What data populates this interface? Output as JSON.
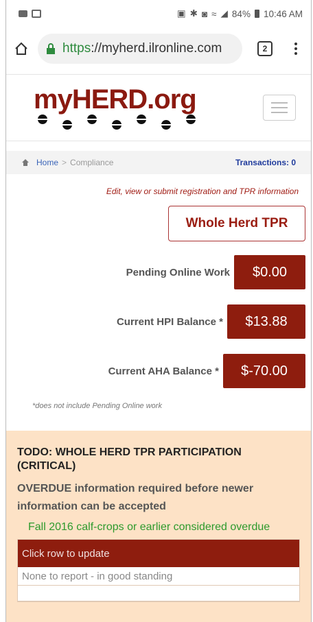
{
  "status_bar": {
    "battery": "84%",
    "time": "10:46 AM"
  },
  "browser": {
    "url_scheme": "https",
    "url_rest": "://myherd.ilronline.com",
    "tab_count": "2"
  },
  "site": {
    "logo": "myHERD.org"
  },
  "breadcrumb": {
    "home": "Home",
    "sep": ">",
    "current": "Compliance",
    "transactions": "Transactions: 0"
  },
  "main": {
    "note": "Edit, view or submit registration and TPR information",
    "tpr_button": "Whole Herd TPR",
    "balances": [
      {
        "label": "Pending Online Work",
        "value": "$0.00"
      },
      {
        "label": "Current HPI Balance *",
        "value": "$13.88"
      },
      {
        "label": "Current AHA Balance *",
        "value": "$-70.00"
      }
    ],
    "footnote": "*does not include Pending Online work"
  },
  "todo": {
    "title": "TODO: WHOLE HERD TPR PARTICIPATION (CRITICAL)",
    "overdue": "OVERDUE information required before newer information can be accepted",
    "note": "Fall 2016 calf-crops or earlier considered overdue",
    "table_header": "Click row to update",
    "row": "None to report - in good standing"
  },
  "colors": {
    "brand": "#8e1d0e",
    "todo_bg": "#fde2c6",
    "ok_green": "#2d9a2d",
    "link_blue": "#3a64b8"
  }
}
